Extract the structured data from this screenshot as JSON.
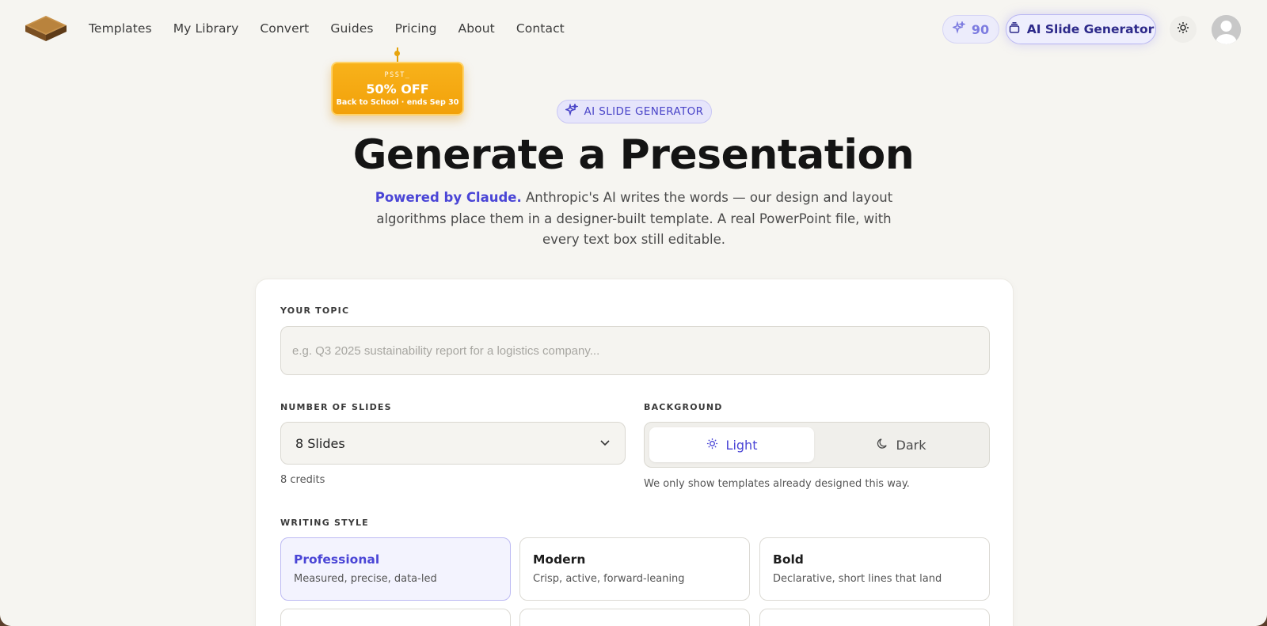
{
  "nav": {
    "links": [
      "Templates",
      "My Library",
      "Convert",
      "Guides",
      "Pricing",
      "About",
      "Contact"
    ],
    "credits": "90",
    "generator_label": "AI Slide Generator"
  },
  "promo": {
    "eyebrow": "PSST_",
    "headline": "50% OFF",
    "sub": "Back to School · ends Sep 30"
  },
  "hero": {
    "badge": "AI SLIDE GENERATOR",
    "title": "Generate a Presentation",
    "sub_accent": "Powered by Claude.",
    "sub_rest": " Anthropic's AI writes the words — our design and layout algorithms place them in a designer-built template. A real PowerPoint file, with every text box still editable."
  },
  "form": {
    "topic_label": "YOUR TOPIC",
    "topic_placeholder": "e.g. Q3 2025 sustainability report for a logistics company...",
    "slides_label": "NUMBER OF SLIDES",
    "slides_value": "8 Slides",
    "slides_note": "8 credits",
    "background_label": "BACKGROUND",
    "background_options": [
      "Light",
      "Dark"
    ],
    "background_selected": "Light",
    "background_note": "We only show templates already designed this way.",
    "writing_label": "WRITING STYLE",
    "styles": [
      {
        "title": "Professional",
        "desc": "Measured, precise, data-led"
      },
      {
        "title": "Modern",
        "desc": "Crisp, active, forward-leaning"
      },
      {
        "title": "Bold",
        "desc": "Declarative, short lines that land"
      }
    ]
  },
  "colors": {
    "accent": "#4a45d6",
    "promo": "#f2a10a",
    "page_bg": "#f6f5f1"
  }
}
